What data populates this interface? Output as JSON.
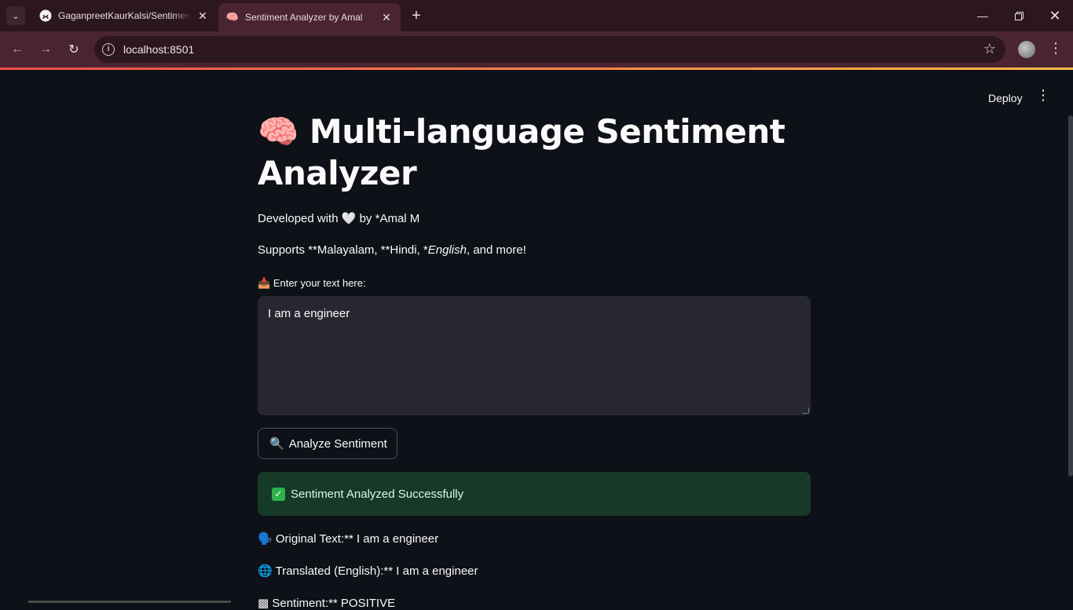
{
  "browser": {
    "tabs": [
      {
        "title": "GaganpreetKaurKalsi/Sentiment-Analysis",
        "favicon": "github-icon",
        "active": false
      },
      {
        "title": "Sentiment Analyzer by Amal",
        "favicon": "brain-icon",
        "active": true
      }
    ],
    "address": "localhost:8501",
    "colors": {
      "tabbar": "#2c171f",
      "toolbar": "#4a2430",
      "loadbar_start": "#ff4b4b",
      "loadbar_end": "#ffbd45"
    }
  },
  "app": {
    "deploy_label": "Deploy",
    "title_emoji": "🧠",
    "title": "Multi-language Sentiment Analyzer",
    "developed_prefix": "Developed with",
    "developed_heart": "🤍",
    "developed_suffix": "by *Amal M",
    "supports_prefix": "Supports **Malayalam, **Hindi, *",
    "supports_em": "English",
    "supports_suffix": ", and more!",
    "input_label_emoji": "📥",
    "input_label": "Enter your text here:",
    "input_value": "I am a engineer",
    "analyze_emoji": "🔍",
    "analyze_label": "Analyze Sentiment",
    "success_message": "Sentiment Analyzed Successfully",
    "result_original_emoji": "🗣️",
    "result_original": "Original Text:** I am a engineer",
    "result_translated_emoji": "🌐",
    "result_translated": "Translated (English):** I am a engineer",
    "result_sentiment_partial": "Sentiment:** POSITIVE",
    "colors": {
      "background": "#0e1117",
      "input_bg": "#262730",
      "success_bg": "#173928",
      "text": "#fafafa"
    }
  }
}
